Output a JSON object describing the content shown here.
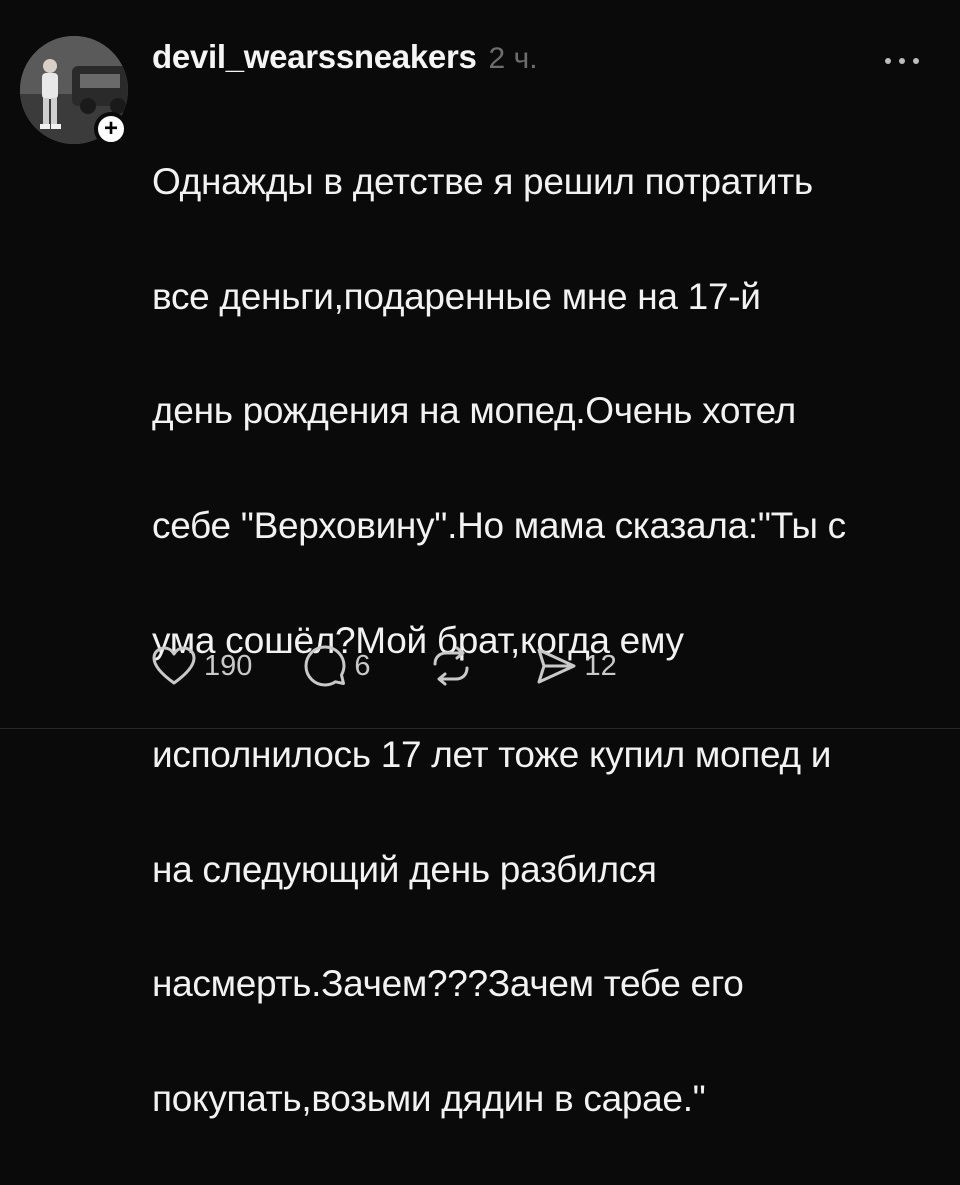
{
  "post": {
    "username": "devil_wearssneakers",
    "time": "2 ч.",
    "text_lines": [
      "Однажды в детстве я решил потратить",
      "все деньги,подаренные мне на 17-й",
      "день рождения на мопед.Очень хотел",
      "себе \"Верховину\".Но мама сказала:\"Ты с",
      "ума сошёл?Мой брат,когда ему",
      "исполнилось 17 лет тоже купил мопед и",
      "на следующий день разбился",
      "насмерть.Зачем???Зачем тебе его",
      "покупать,возьми дядин в сарае.\""
    ],
    "actions": {
      "likes": "190",
      "replies": "6",
      "reposts": "",
      "shares": "12"
    }
  },
  "icons": {
    "follow": "plus-icon",
    "more": "more-horizontal-icon",
    "like": "heart-icon",
    "reply": "comment-icon",
    "repost": "repost-icon",
    "share": "send-icon"
  },
  "colors": {
    "background": "#0a0a0a",
    "text": "#f2f2f2",
    "muted": "#6d6d6d",
    "icon": "#c9c9c9"
  }
}
